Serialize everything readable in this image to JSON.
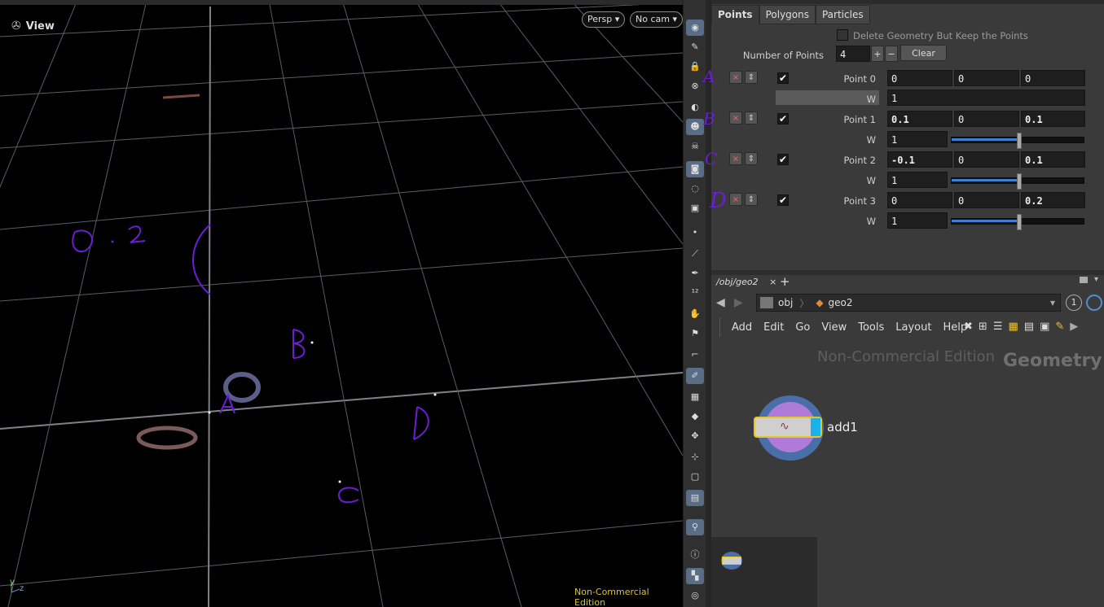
{
  "viewport": {
    "title": "View",
    "camera_button": "Persp",
    "cam_dropdown": "No cam",
    "watermark": "Non-Commercial Edition",
    "axis_y": "y",
    "axis_z": "z",
    "annotations": {
      "a": "A",
      "b": "B",
      "c": "C",
      "d": "D",
      "dim": "0.2"
    }
  },
  "params": {
    "tabs": [
      "Points",
      "Polygons",
      "Particles"
    ],
    "delete_geometry_label": "Delete Geometry But Keep the Points",
    "num_points_label": "Number of Points",
    "num_points_value": "4",
    "plus": "+",
    "minus": "−",
    "clear_label": "Clear",
    "w_label": "W",
    "points": [
      {
        "label": "Point 0",
        "x": "0",
        "y": "0",
        "z": "0",
        "w": "1",
        "annot": "A"
      },
      {
        "label": "Point 1",
        "x": "0.1",
        "y": "0",
        "z": "0.1",
        "w": "1",
        "annot": "B"
      },
      {
        "label": "Point 2",
        "x": "-0.1",
        "y": "0",
        "z": "0.1",
        "w": "1",
        "annot": "C"
      },
      {
        "label": "Point 3",
        "x": "0",
        "y": "0",
        "z": "0.2",
        "w": "1",
        "annot": "D"
      }
    ]
  },
  "network": {
    "path_tab": "/obj/geo2",
    "path_close": "×",
    "add_tab": "+",
    "crumb_obj": "obj",
    "crumb_geo": "geo2",
    "badge": "1",
    "menus": [
      "Add",
      "Edit",
      "Go",
      "View",
      "Tools",
      "Layout",
      "Help"
    ],
    "watermark": "Non-Commercial Edition",
    "context": "Geometry",
    "node_name": "add1"
  },
  "colors": {
    "annotation": "#6a1fd6",
    "slider": "#3d7fd1",
    "node_outline": "#e8c620",
    "watermark_vp": "#d8c23a"
  }
}
